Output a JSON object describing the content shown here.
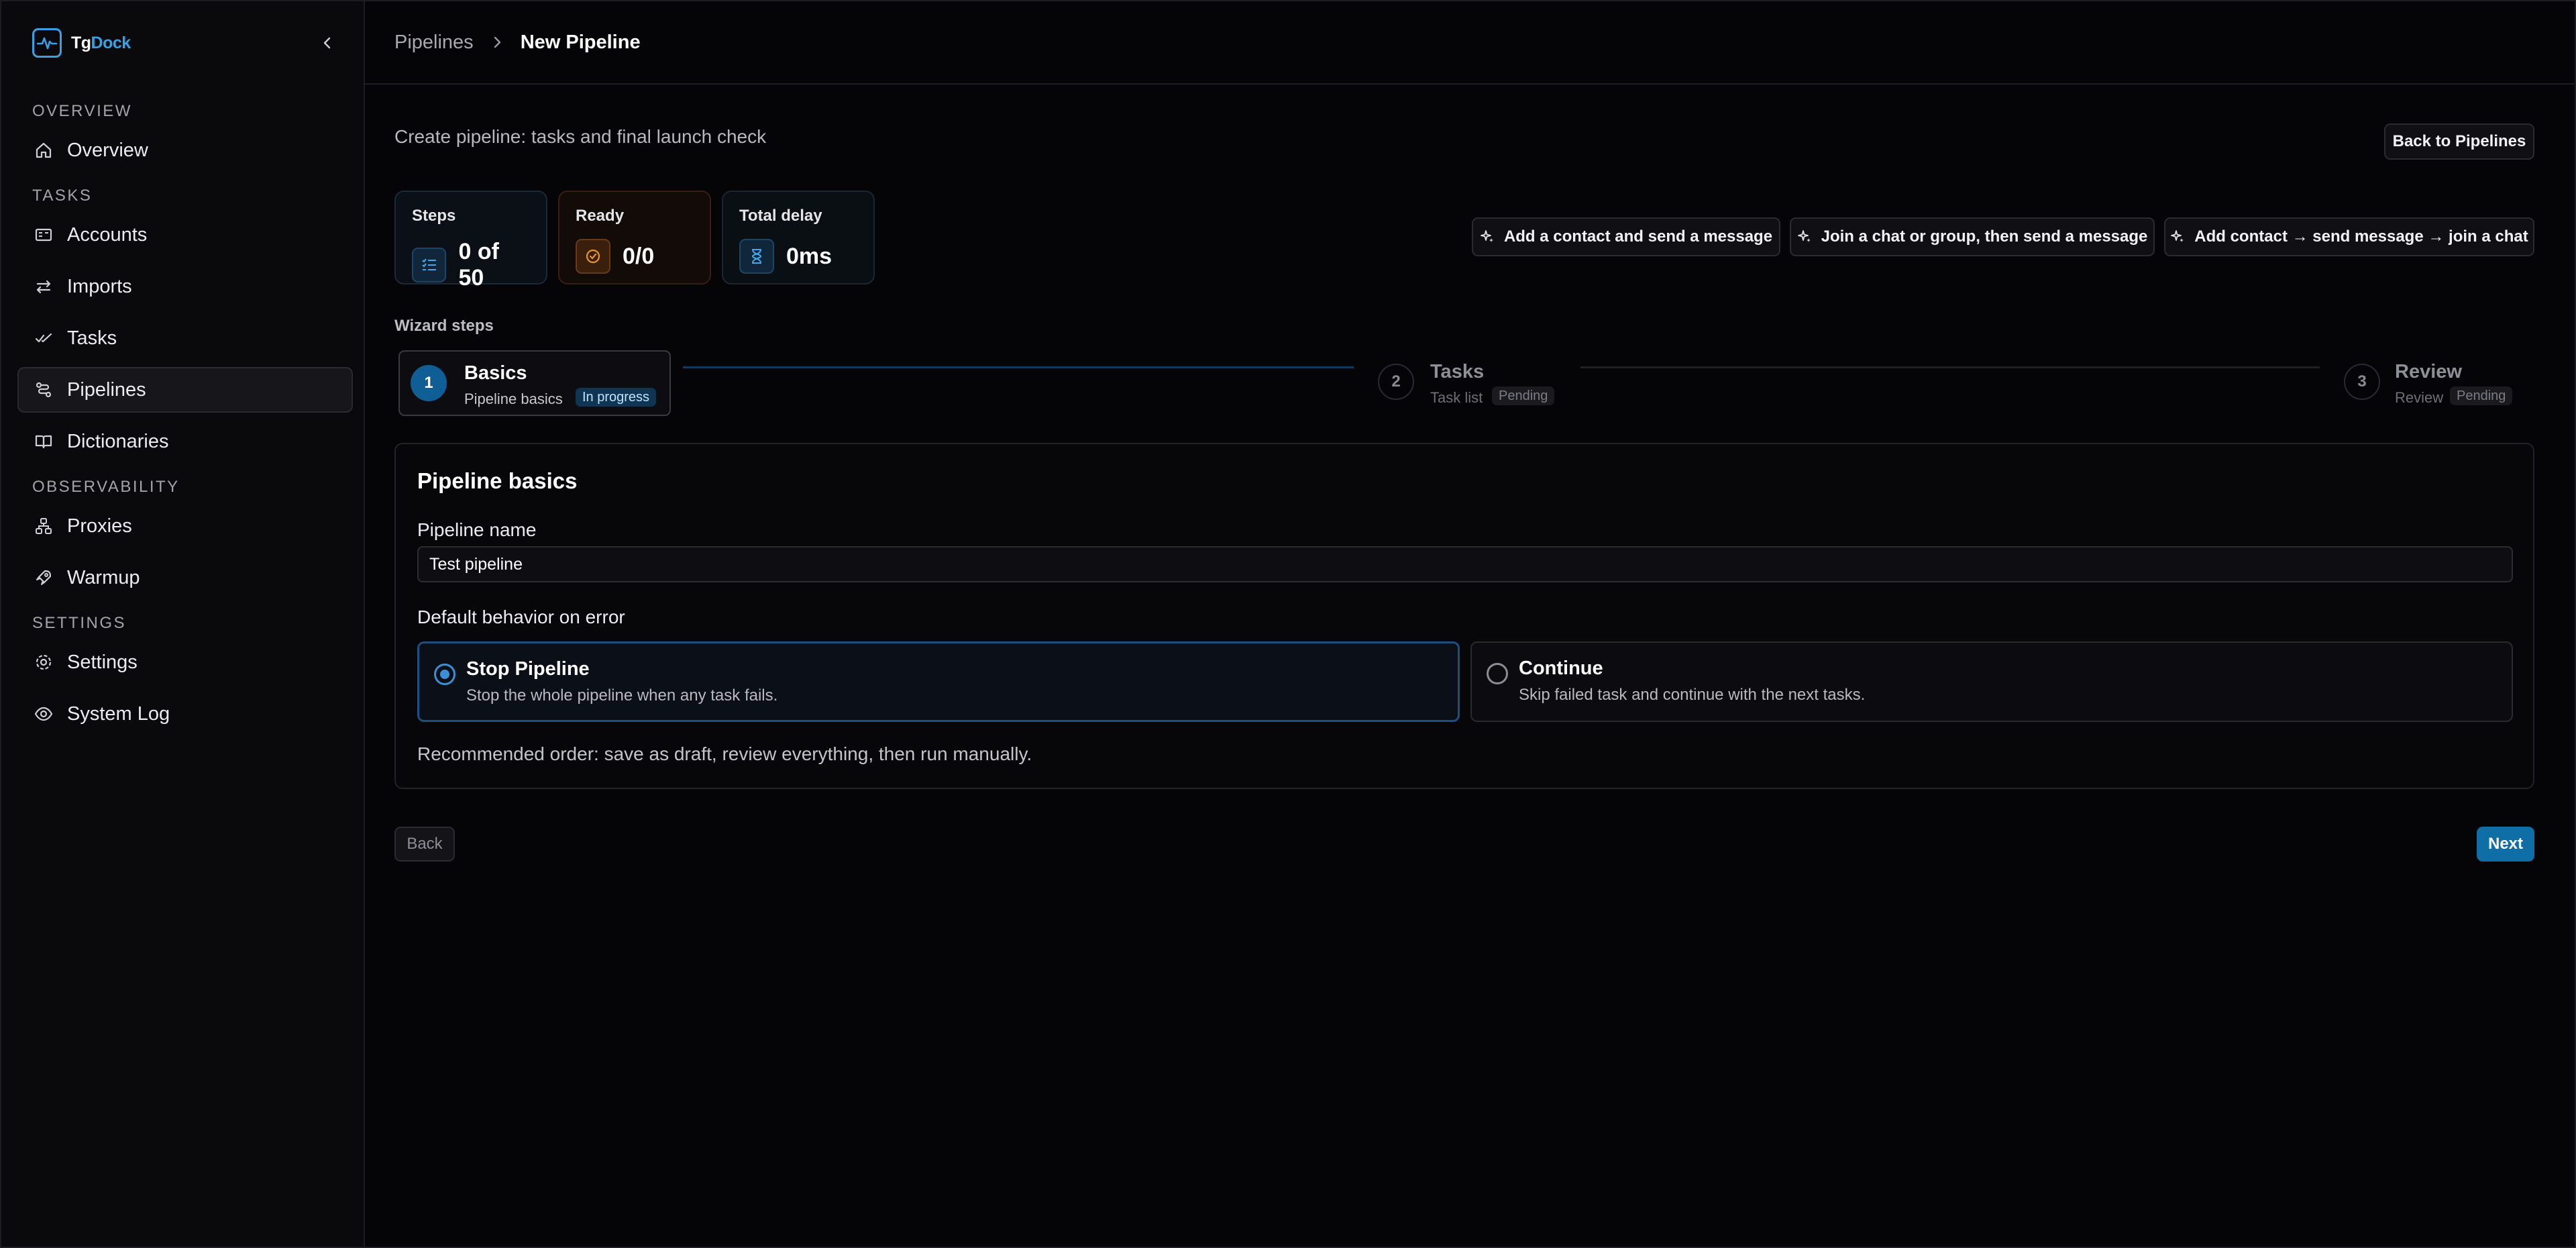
{
  "colors": {
    "accent": "#3a8fd6",
    "primary_button": "#0f6ea6",
    "background": "#050507",
    "warning": "#e8962a"
  },
  "brand": {
    "name_part1": "Tg",
    "name_part2": "Dock"
  },
  "sidebar": {
    "sections": [
      "OVERVIEW",
      "TASKS",
      "OBSERVABILITY",
      "SETTINGS"
    ],
    "items": [
      {
        "label": "Overview",
        "icon": "home-icon"
      },
      {
        "label": "Accounts",
        "icon": "id-card-icon"
      },
      {
        "label": "Imports",
        "icon": "arrows-swap-icon"
      },
      {
        "label": "Tasks",
        "icon": "check-double-icon"
      },
      {
        "label": "Pipelines",
        "icon": "workflow-icon",
        "active": true
      },
      {
        "label": "Dictionaries",
        "icon": "book-icon"
      },
      {
        "label": "Proxies",
        "icon": "network-icon"
      },
      {
        "label": "Warmup",
        "icon": "rocket-icon"
      },
      {
        "label": "Settings",
        "icon": "gear-icon"
      },
      {
        "label": "System Log",
        "icon": "eye-icon"
      }
    ]
  },
  "breadcrumb": {
    "parent": "Pipelines",
    "current": "New Pipeline"
  },
  "page": {
    "subtitle": "Create pipeline: tasks and final launch check",
    "back_to_pipelines": "Back to Pipelines",
    "templates": [
      "Add a contact and send a message",
      "Join a chat or group, then send a message",
      "Add contact → send message → join a chat"
    ]
  },
  "stats": {
    "steps": {
      "label": "Steps",
      "value": "0 of 50"
    },
    "ready": {
      "label": "Ready",
      "value": "0/0"
    },
    "delay": {
      "label": "Total delay",
      "value": "0ms"
    }
  },
  "wizard": {
    "label": "Wizard steps",
    "steps": [
      {
        "num": "1",
        "title": "Basics",
        "sub": "Pipeline basics",
        "badge": "In progress"
      },
      {
        "num": "2",
        "title": "Tasks",
        "sub": "Task list",
        "badge": "Pending"
      },
      {
        "num": "3",
        "title": "Review",
        "sub": "Review",
        "badge": "Pending"
      }
    ]
  },
  "form": {
    "title": "Pipeline basics",
    "name_label": "Pipeline name",
    "name_value": "Test pipeline",
    "error_label": "Default behavior on error",
    "options": [
      {
        "title": "Stop Pipeline",
        "desc": "Stop the whole pipeline when any task fails.",
        "selected": true
      },
      {
        "title": "Continue",
        "desc": "Skip failed task and continue with the next tasks.",
        "selected": false
      }
    ],
    "note": "Recommended order: save as draft, review everything, then run manually."
  },
  "footer": {
    "back": "Back",
    "next": "Next"
  }
}
